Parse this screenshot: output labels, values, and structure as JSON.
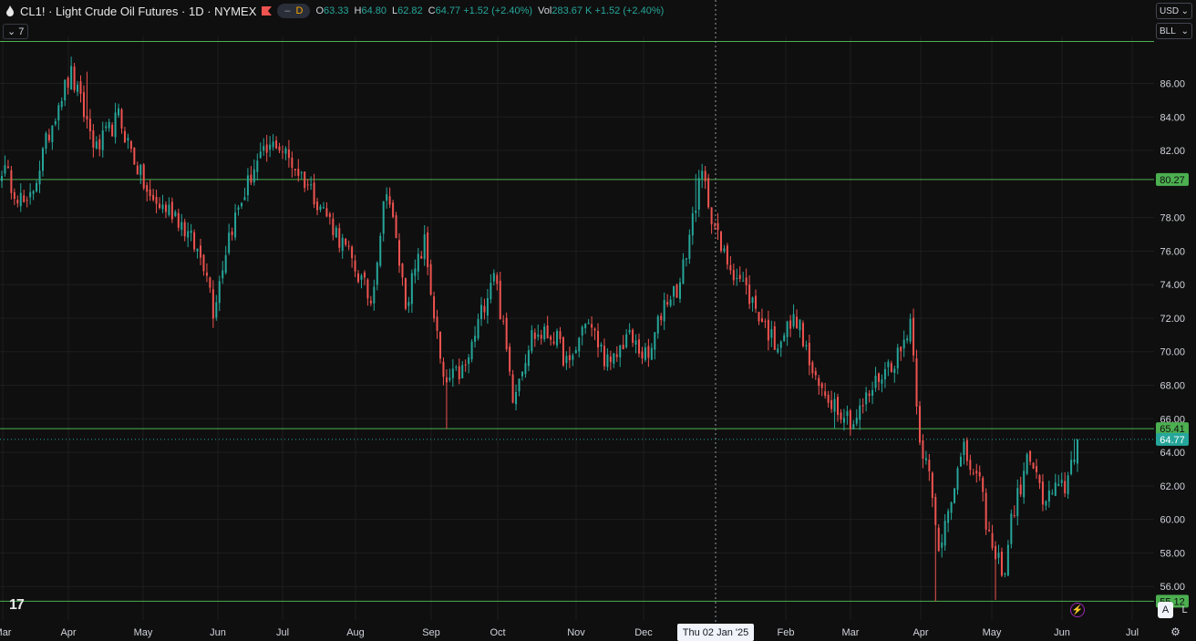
{
  "header": {
    "symbol_title": "CL1! · Light Crude Oil Futures · 1D · NYMEX",
    "pill_dash": "–",
    "pill_d": "D",
    "ohlc": [
      {
        "k": "O",
        "v": "63.33"
      },
      {
        "k": "H",
        "v": "64.80"
      },
      {
        "k": "L",
        "v": "62.82"
      },
      {
        "k": "C",
        "v": "64.77 +1.52 (+2.40%)"
      },
      {
        "k": "Vol",
        "v": "283.67 K +1.52 (+2.40%)"
      }
    ],
    "indicator_count": "7"
  },
  "axis_controls": {
    "currency": "USD",
    "unit": "BLL"
  },
  "crosshair_date": "Thu 02 Jan '25",
  "buttons": {
    "auto": "A",
    "log": "L"
  },
  "colors": {
    "up": "#26a69a",
    "down": "#ef5350",
    "hline": "#4caf50",
    "grid": "#1e1e1e",
    "background": "#0f0f0f"
  },
  "chart_data": {
    "type": "candlestick",
    "ylim": [
      54,
      88.8
    ],
    "y_ticks": [
      "86.00",
      "84.00",
      "82.00",
      "78.00",
      "76.00",
      "74.00",
      "72.00",
      "70.00",
      "68.00",
      "66.00",
      "64.00",
      "62.00",
      "60.00",
      "58.00",
      "56.00"
    ],
    "x_labels": [
      "Mar",
      "Apr",
      "May",
      "Jun",
      "Jul",
      "Aug",
      "Sep",
      "Oct",
      "Nov",
      "Dec",
      "Feb",
      "Mar",
      "Apr",
      "May",
      "Jun",
      "Jul"
    ],
    "horizontal_levels": [
      {
        "value": 88.5,
        "label": ""
      },
      {
        "value": 80.27,
        "label": "80.27"
      },
      {
        "value": 65.41,
        "label": "65.41"
      },
      {
        "value": 55.12,
        "label": "55.12"
      }
    ],
    "last_price": {
      "value": 64.77,
      "label": "64.77"
    },
    "close_anchors": [
      [
        0,
        81
      ],
      [
        8,
        78.5
      ],
      [
        18,
        85
      ],
      [
        22,
        86.5
      ],
      [
        30,
        82
      ],
      [
        37,
        84
      ],
      [
        47,
        79
      ],
      [
        55,
        78.3
      ],
      [
        65,
        75
      ],
      [
        67,
        72.5
      ],
      [
        72,
        77
      ],
      [
        80,
        81
      ],
      [
        87,
        82.5
      ],
      [
        97,
        80
      ],
      [
        105,
        77.5
      ],
      [
        112,
        75
      ],
      [
        117,
        73
      ],
      [
        122,
        80
      ],
      [
        128,
        73
      ],
      [
        134,
        76.5
      ],
      [
        140,
        68
      ],
      [
        147,
        69
      ],
      [
        156,
        75
      ],
      [
        162,
        67.5
      ],
      [
        168,
        71
      ],
      [
        175,
        71
      ],
      [
        180,
        69
      ],
      [
        185,
        72
      ],
      [
        193,
        69
      ],
      [
        198,
        71
      ],
      [
        205,
        69.5
      ],
      [
        210,
        73
      ],
      [
        215,
        74
      ],
      [
        220,
        79
      ],
      [
        222,
        80.5
      ],
      [
        228,
        76
      ],
      [
        235,
        74
      ],
      [
        245,
        70.5
      ],
      [
        252,
        72
      ],
      [
        258,
        68
      ],
      [
        264,
        67
      ],
      [
        270,
        65.8
      ],
      [
        278,
        68.5
      ],
      [
        285,
        70
      ],
      [
        288,
        72
      ],
      [
        291,
        65
      ],
      [
        294,
        62.5
      ],
      [
        297,
        58
      ],
      [
        300,
        61
      ],
      [
        305,
        64
      ],
      [
        310,
        62
      ],
      [
        314,
        58
      ],
      [
        318,
        57
      ],
      [
        320,
        60
      ],
      [
        326,
        64
      ],
      [
        330,
        61
      ],
      [
        333,
        61.5
      ],
      [
        337,
        62
      ],
      [
        340,
        64
      ],
      [
        341,
        64.77
      ]
    ],
    "wick_extremes": [
      [
        27,
        86.7
      ],
      [
        97,
        80.3
      ],
      [
        141,
        65.41
      ],
      [
        220,
        80.6
      ],
      [
        264,
        65.41
      ],
      [
        296,
        55.12
      ],
      [
        315,
        55.2
      ],
      [
        340,
        64.8
      ]
    ]
  }
}
